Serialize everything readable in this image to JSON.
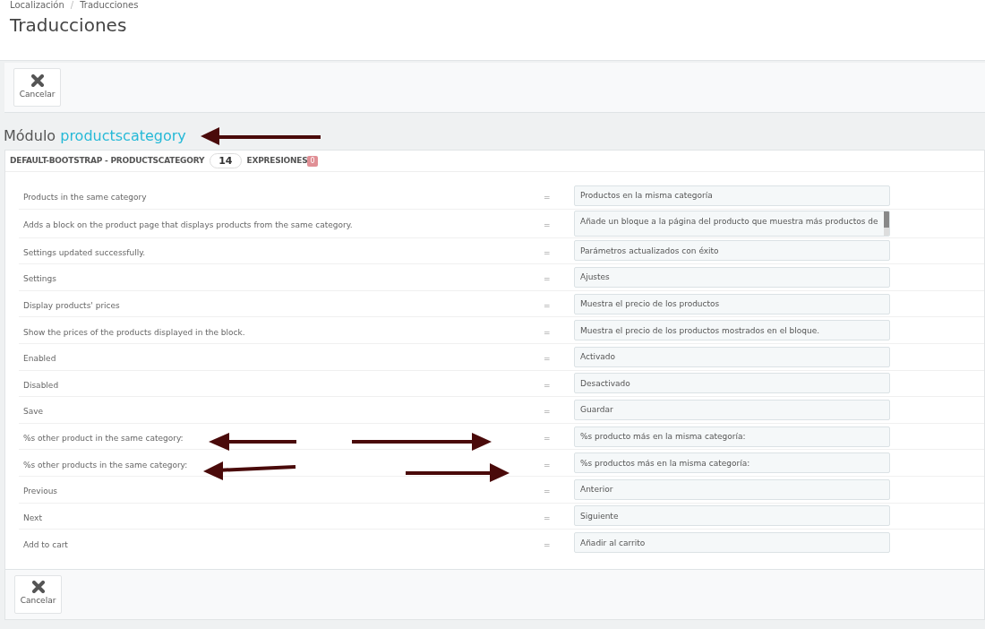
{
  "breadcrumb": [
    "Localización",
    "Traducciones"
  ],
  "breadcrumb_separator": "/",
  "title": "Traducciones",
  "toolbar_top": {
    "button": "Cancelar"
  },
  "module": {
    "prefix": "Módulo",
    "name": "productscategory"
  },
  "panel": {
    "heading": "DEFAULT-BOOTSTRAP - PRODUCTSCATEGORY",
    "count": "14",
    "label": "EXPRESIONES",
    "missing": "0"
  },
  "rows": [
    {
      "source": "Products in the same category",
      "translation": "Productos en la misma categoría",
      "kind": "input"
    },
    {
      "source": "Adds a block on the product page that displays products from the same category.",
      "translation": "Añade un bloque a la página del producto que muestra más productos de",
      "kind": "textarea"
    },
    {
      "source": "Settings updated successfully.",
      "translation": "Parámetros actualizados con éxito",
      "kind": "input"
    },
    {
      "source": "Settings",
      "translation": "Ajustes",
      "kind": "input"
    },
    {
      "source": "Display products' prices",
      "translation": "Muestra el precio de los productos",
      "kind": "input"
    },
    {
      "source": "Show the prices of the products displayed in the block.",
      "translation": "Muestra el precio de los productos mostrados en el bloque.",
      "kind": "input"
    },
    {
      "source": "Enabled",
      "translation": "Activado",
      "kind": "input"
    },
    {
      "source": "Disabled",
      "translation": "Desactivado",
      "kind": "input"
    },
    {
      "source": "Save",
      "translation": "Guardar",
      "kind": "input"
    },
    {
      "source": "%s other product in the same category:",
      "translation": "%s producto más en la misma categoría:",
      "kind": "input"
    },
    {
      "source": "%s other products in the same category:",
      "translation": "%s productos más en la misma categoría:",
      "kind": "input"
    },
    {
      "source": "Previous",
      "translation": "Anterior",
      "kind": "input"
    },
    {
      "source": "Next",
      "translation": "Siguiente",
      "kind": "input"
    },
    {
      "source": "Add to cart",
      "translation": "Añadir al carrito",
      "kind": "input"
    }
  ],
  "separator": "=",
  "toolbar_bottom": {
    "button": "Cancelar"
  }
}
